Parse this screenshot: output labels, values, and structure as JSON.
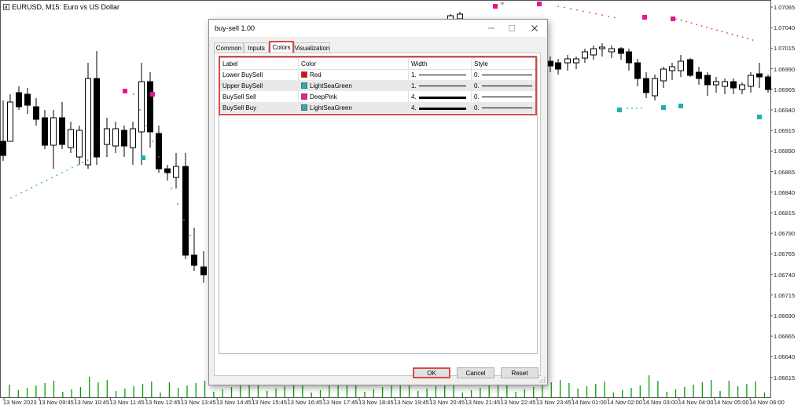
{
  "chart": {
    "symbol_title": "EURUSD, M15:  Euro vs US Dollar",
    "price_labels": [
      "1.07065",
      "1.07040",
      "1.07015",
      "1.06990",
      "1.06965",
      "1.06940",
      "1.06915",
      "1.06890",
      "1.06865",
      "1.06840",
      "1.06815",
      "1.06790",
      "1.06765",
      "1.06740",
      "1.06715",
      "1.06690",
      "1.06665",
      "1.06640",
      "1.06615"
    ],
    "time_labels": [
      "13 Nov 2023",
      "13 Nov 09:45",
      "13 Nov 10:45",
      "13 Nov 11:45",
      "13 Nov 12:45",
      "13 Nov 13:45",
      "13 Nov 14:45",
      "13 Nov 15:45",
      "13 Nov 16:45",
      "13 Nov 17:45",
      "13 Nov 18:45",
      "13 Nov 19:45",
      "13 Nov 20:45",
      "13 Nov 21:45",
      "13 Nov 22:45",
      "13 Nov 23:45",
      "14 Nov 01:00",
      "14 Nov 02:00",
      "14 Nov 03:00",
      "14 Nov 04:00",
      "14 Nov 05:00",
      "14 Nov 06:00"
    ],
    "colors": {
      "bull": "#ffffff",
      "bear": "#000000",
      "pink": "#e8158f",
      "teal": "#20b2aa",
      "red_dot": "#e23b3b",
      "volume": "#00a000"
    }
  },
  "dialog": {
    "title": "buy-sell 1.00",
    "tabs": [
      "Common",
      "Inputs",
      "Colors",
      "Visualization"
    ],
    "active_tab": "Colors",
    "table": {
      "headers": [
        "Label",
        "Color",
        "Width",
        "Style"
      ],
      "rows": [
        {
          "label": "Lower BuySell",
          "color_name": "Red",
          "color": "#ff0000",
          "width": "1.",
          "style": "0."
        },
        {
          "label": "Upper BuySell",
          "color_name": "LightSeaGreen",
          "color": "#20b2aa",
          "width": "1.",
          "style": "0."
        },
        {
          "label": "BuySell Sell",
          "color_name": "DeepPink",
          "color": "#ff1493",
          "width": "4.",
          "style": "0."
        },
        {
          "label": "BuySell Buy",
          "color_name": "LightSeaGreen",
          "color": "#20b2aa",
          "width": "4.",
          "style": "0."
        }
      ]
    },
    "buttons": {
      "ok": "OK",
      "cancel": "Cancel",
      "reset": "Reset"
    }
  }
}
